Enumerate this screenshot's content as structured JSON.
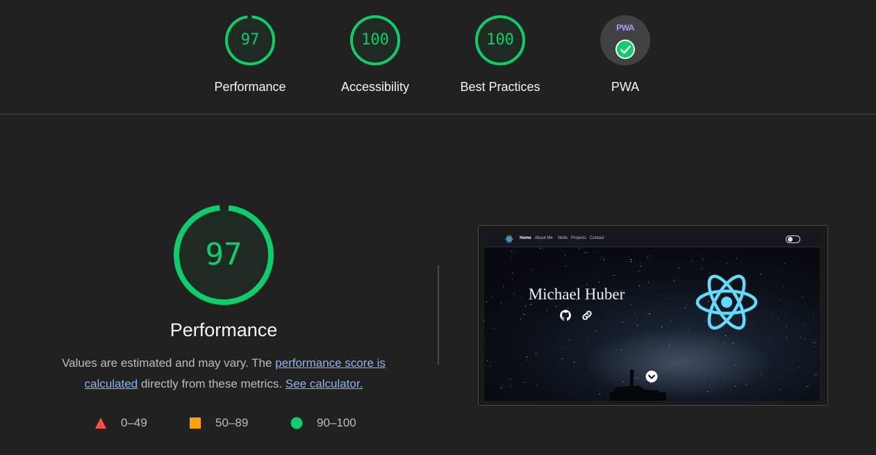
{
  "colors": {
    "pass": "#0cce6b",
    "average": "#ffa400",
    "fail": "#ff4e42",
    "link": "#8ab4f8"
  },
  "categories": [
    {
      "score": "97",
      "label": "Performance",
      "fraction": 0.97
    },
    {
      "score": "100",
      "label": "Accessibility",
      "fraction": 1.0
    },
    {
      "score": "100",
      "label": "Best Practices",
      "fraction": 1.0
    },
    {
      "label": "PWA",
      "badge_text": "PWA",
      "badge_icon": "check-circle-icon"
    }
  ],
  "performance": {
    "score": "97",
    "fraction": 0.97,
    "title": "Performance",
    "desc_prefix": "Values are estimated and may vary. The ",
    "desc_link1": "performance score is calculated",
    "desc_middle": " directly from these metrics. ",
    "desc_link2": "See calculator."
  },
  "legend": [
    {
      "shape": "triangle",
      "label": "0–49"
    },
    {
      "shape": "square",
      "label": "50–89"
    },
    {
      "shape": "circle",
      "label": "90–100"
    }
  ],
  "screenshot": {
    "nav_links": [
      "Home",
      "About Me",
      "Skills",
      "Projects",
      "Contact"
    ],
    "name": "Michael Huber",
    "icons": [
      "github-icon",
      "link-icon",
      "react-logo-icon",
      "chevron-down-icon",
      "toggle-icon"
    ]
  }
}
